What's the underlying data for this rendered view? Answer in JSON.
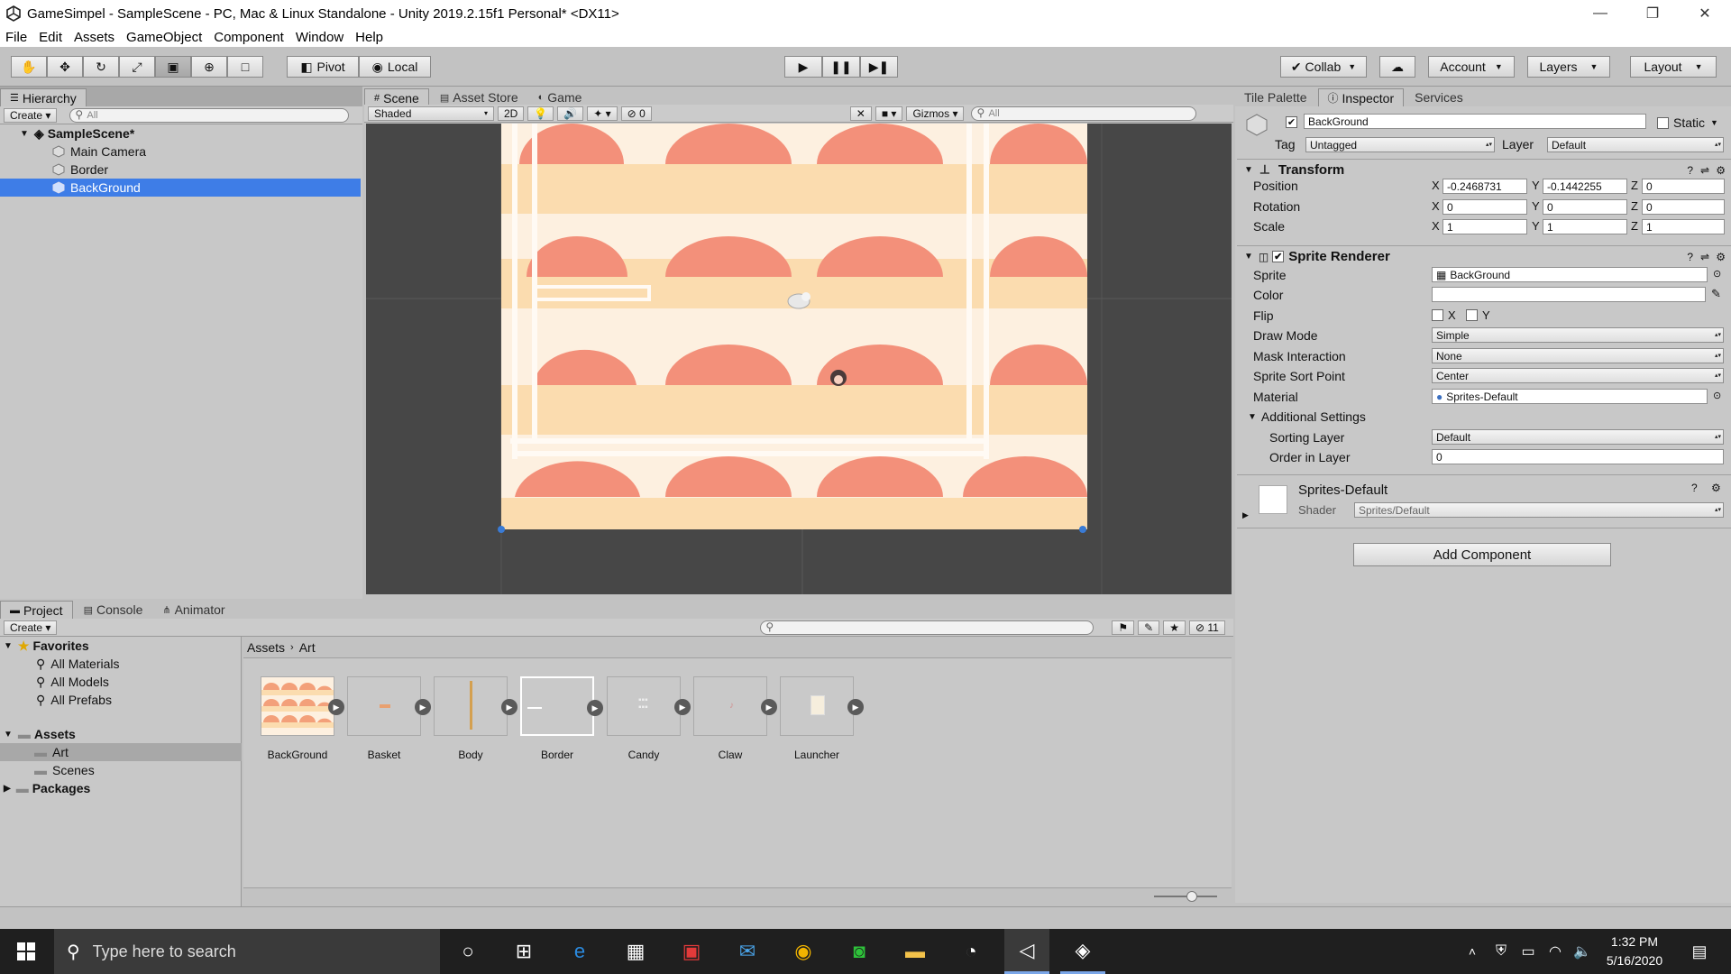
{
  "window": {
    "title": "GameSimpel - SampleScene - PC, Mac & Linux Standalone - Unity 2019.2.15f1 Personal* <DX11>",
    "minimize": "—",
    "restore": "❐",
    "close": "✕"
  },
  "menu": [
    "File",
    "Edit",
    "Assets",
    "GameObject",
    "Component",
    "Window",
    "Help"
  ],
  "toolbar": {
    "pivot": "Pivot",
    "local": "Local",
    "collab": "Collab",
    "account": "Account",
    "layers": "Layers",
    "layout": "Layout",
    "tools": [
      "hand-tool-icon",
      "move-tool-icon",
      "rotate-tool-icon",
      "scale-tool-icon",
      "rect-tool-icon",
      "transform-tool-icon",
      "custom-tool-icon"
    ],
    "play_controls": [
      "play-icon",
      "pause-icon",
      "step-icon"
    ]
  },
  "hierarchy": {
    "tab": "Hierarchy",
    "create": "Create",
    "search_placeholder": "All",
    "scene": "SampleScene*",
    "items": [
      "Main Camera",
      "Border",
      "BackGround"
    ],
    "selected": "BackGround"
  },
  "scene_view": {
    "tabs": [
      "Scene",
      "Asset Store",
      "Game"
    ],
    "shading": "Shaded",
    "mode_2d": "2D",
    "fx_count": "0",
    "gizmos": "Gizmos",
    "search_placeholder": "All"
  },
  "inspector": {
    "tabs": [
      "Tile Palette",
      "Inspector",
      "Services"
    ],
    "object_name": "BackGround",
    "static_label": "Static",
    "tag_label": "Tag",
    "tag_value": "Untagged",
    "layer_label": "Layer",
    "layer_value": "Default",
    "transform": {
      "title": "Transform",
      "position_label": "Position",
      "rotation_label": "Rotation",
      "scale_label": "Scale",
      "position": [
        "-0.2468731",
        "-0.1442255",
        "0"
      ],
      "rotation": [
        "0",
        "0",
        "0"
      ],
      "scale": [
        "1",
        "1",
        "1"
      ]
    },
    "sprite_renderer": {
      "title": "Sprite Renderer",
      "sprite_label": "Sprite",
      "sprite_value": "BackGround",
      "color_label": "Color",
      "flip_label": "Flip",
      "flip_x": "X",
      "flip_y": "Y",
      "draw_mode_label": "Draw Mode",
      "draw_mode_value": "Simple",
      "mask_label": "Mask Interaction",
      "mask_value": "None",
      "sort_point_label": "Sprite Sort Point",
      "sort_point_value": "Center",
      "material_label": "Material",
      "material_value": "Sprites-Default",
      "additional_label": "Additional Settings",
      "sorting_layer_label": "Sorting Layer",
      "sorting_layer_value": "Default",
      "order_label": "Order in Layer",
      "order_value": "0"
    },
    "material": {
      "name": "Sprites-Default",
      "shader_label": "Shader",
      "shader_value": "Sprites/Default"
    },
    "add_component": "Add Component"
  },
  "project": {
    "tabs": [
      "Project",
      "Console",
      "Animator"
    ],
    "create": "Create",
    "favorites_label": "Favorites",
    "favorites": [
      "All Materials",
      "All Models",
      "All Prefabs"
    ],
    "assets_label": "Assets",
    "asset_folders": [
      "Art",
      "Scenes"
    ],
    "packages_label": "Packages",
    "breadcrumb": [
      "Assets",
      "Art"
    ],
    "hidden_count": "11",
    "assets": [
      "BackGround",
      "Basket",
      "Body",
      "Border",
      "Candy",
      "Claw",
      "Launcher"
    ]
  },
  "taskbar": {
    "search_placeholder": "Type here to search",
    "time": "1:32 PM",
    "date": "5/16/2020"
  },
  "colors": {
    "selection": "#3e7de7",
    "bg_cream": "#fbe2c0",
    "bg_light": "#fdf0e0",
    "bump_salmon": "#f3907a",
    "scene_dark": "#474747"
  }
}
